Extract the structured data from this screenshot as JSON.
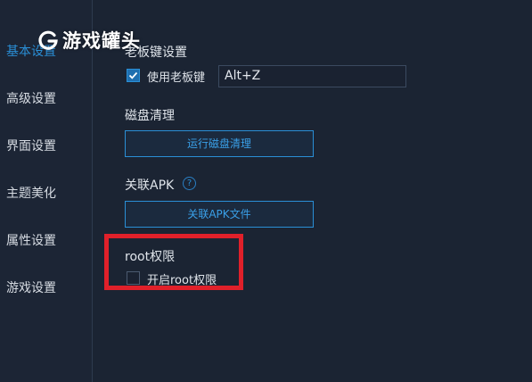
{
  "watermark": {
    "text": "游戏罐头"
  },
  "sidebar": {
    "items": [
      {
        "label": "基本设置",
        "active": true
      },
      {
        "label": "高级设置",
        "active": false
      },
      {
        "label": "界面设置",
        "active": false
      },
      {
        "label": "主题美化",
        "active": false
      },
      {
        "label": "属性设置",
        "active": false
      },
      {
        "label": "游戏设置",
        "active": false
      }
    ]
  },
  "boss_key": {
    "title": "老板键设置",
    "checkbox_label": "使用老板键",
    "checked": true,
    "hotkey_value": "Alt+Z"
  },
  "disk_cleanup": {
    "title": "磁盘清理",
    "button_label": "运行磁盘清理"
  },
  "apk_association": {
    "title": "关联APK",
    "help_icon": "?",
    "button_label": "关联APK文件"
  },
  "root_permission": {
    "title": "root权限",
    "checkbox_label": "开启root权限",
    "checked": false
  },
  "colors": {
    "accent": "#2a8fd6",
    "highlight_border": "#e0202a",
    "background": "#1b2433"
  }
}
